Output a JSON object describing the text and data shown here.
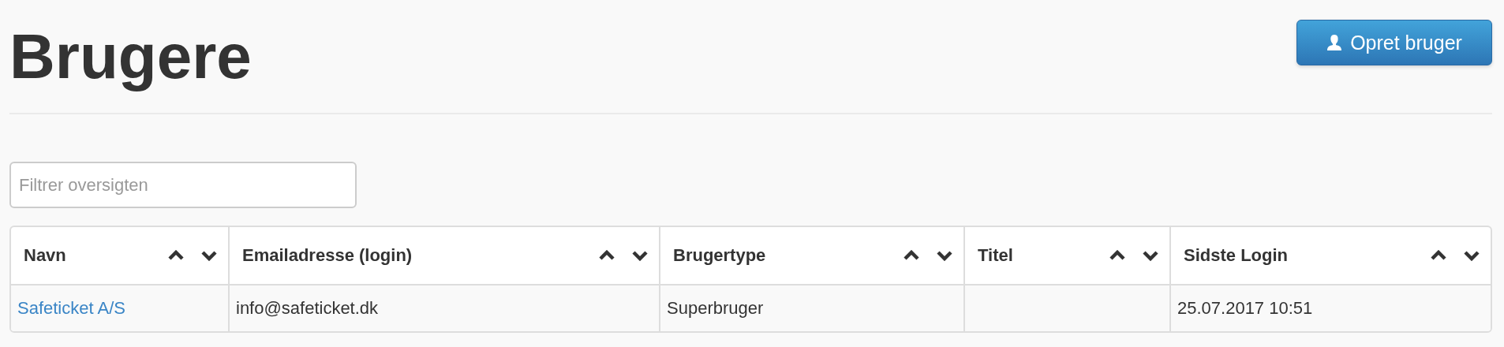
{
  "page_title": "Brugere",
  "create_button": {
    "label": "Opret bruger"
  },
  "filter": {
    "placeholder": "Filtrer oversigten"
  },
  "table": {
    "columns": [
      {
        "label": "Navn"
      },
      {
        "label": "Emailadresse (login)"
      },
      {
        "label": "Brugertype"
      },
      {
        "label": "Titel"
      },
      {
        "label": "Sidste Login"
      }
    ],
    "rows": [
      {
        "cells": [
          {
            "kind": "link",
            "text": "Safeticket A/S"
          },
          {
            "kind": "text",
            "text": "info@safeticket.dk"
          },
          {
            "kind": "text",
            "text": "Superbruger"
          },
          {
            "kind": "empty"
          },
          {
            "kind": "text",
            "text": "25.07.2017 10:51"
          }
        ]
      }
    ]
  }
}
